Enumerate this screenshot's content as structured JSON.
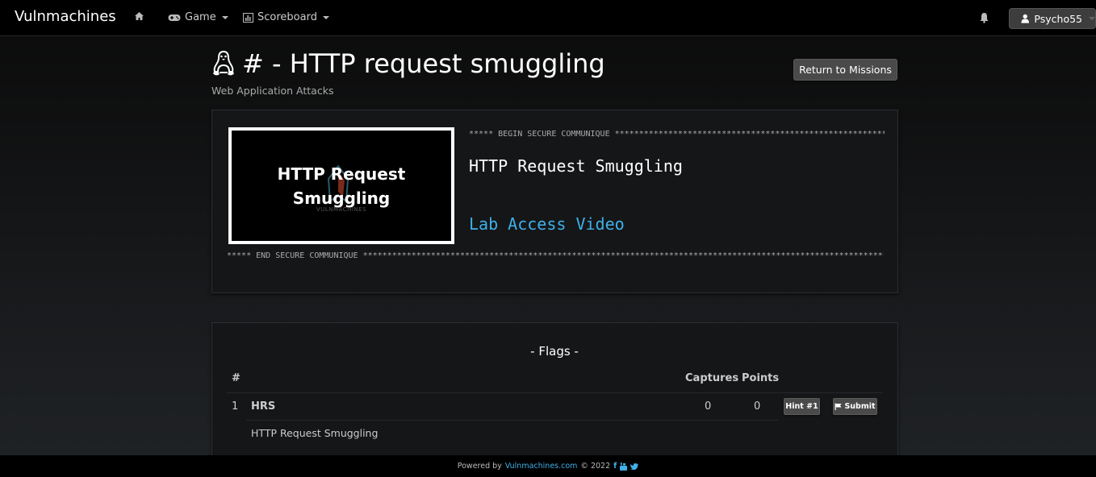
{
  "navbar": {
    "brand": "Vulnmachines",
    "items": [
      {
        "label": "",
        "icon": "home-icon"
      },
      {
        "label": "Game",
        "icon": "gamepad-icon",
        "dropdown": true
      },
      {
        "label": "Scoreboard",
        "icon": "bar-chart-icon",
        "dropdown": true
      }
    ],
    "notifications_icon": "bell-icon",
    "user": {
      "name": "Psycho55",
      "icon": "user-icon"
    }
  },
  "header": {
    "title": "# - HTTP request smuggling",
    "title_icon": "linux-tux-icon",
    "category": "Web Application Attacks",
    "return_button": "Return to Missions"
  },
  "communique": {
    "thumbnail_text_line1": "HTTP Request",
    "thumbnail_text_line2": "Smuggling",
    "thumbnail_watermark": "VULNMACHINES",
    "begin_banner": "***** BEGIN SECURE COMMUNIQUE ****************************************************************************************",
    "title": "HTTP Request Smuggling",
    "link_label": "Lab Access Video",
    "end_banner": "***** END SECURE COMMUNIQUE ********************************************************************************************************************"
  },
  "flags": {
    "title": "- Flags -",
    "columns": {
      "number": "#",
      "captures": "Captures",
      "points": "Points"
    },
    "rows": [
      {
        "number": "1",
        "name": "HRS",
        "description": "HTTP Request Smuggling",
        "captures": "0",
        "points": "0",
        "hint_button": "Hint #1",
        "submit_button": "Submit"
      }
    ]
  },
  "footer": {
    "powered_by": "Powered by",
    "link": "Vulnmachines.com",
    "copyright": "© 2022",
    "social": [
      "facebook-icon",
      "youtube-icon",
      "twitter-icon"
    ]
  }
}
